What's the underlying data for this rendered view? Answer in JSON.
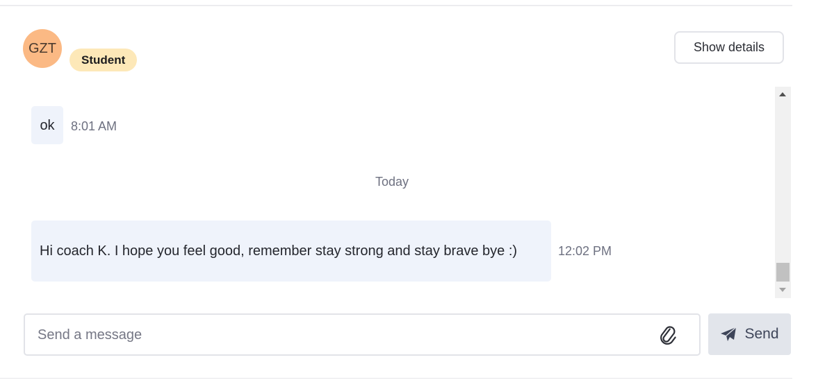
{
  "header": {
    "avatar_initials": "GZT",
    "role_badge": "Student",
    "details_button": "Show details"
  },
  "conversation": {
    "messages": [
      {
        "text": "ok",
        "time": "8:01 AM"
      },
      {
        "text": "Hi coach K. I hope you feel good, remember stay strong and stay brave bye :)",
        "time": "12:02 PM"
      }
    ],
    "day_separator": "Today"
  },
  "composer": {
    "placeholder": "Send a message",
    "value": "",
    "send_label": "Send"
  },
  "icons": {
    "attach": "paperclip-icon",
    "send": "paper-plane-icon"
  },
  "colors": {
    "avatar_bg": "#fbb984",
    "badge_bg": "#fde8b8",
    "bubble_bg": "#eff3fb",
    "send_bg": "#e2e5eb"
  }
}
